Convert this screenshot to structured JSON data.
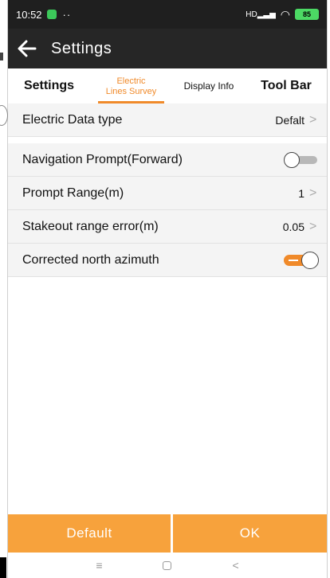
{
  "status_bar": {
    "time": "10:52",
    "dots": "··",
    "signal": "HD",
    "battery": "85"
  },
  "app_bar": {
    "title": "Settings"
  },
  "tabs": [
    {
      "label": "Settings",
      "active": false
    },
    {
      "label": "Electric Lines Survey",
      "line1": "Electric",
      "line2": "Lines Survey",
      "active": true
    },
    {
      "label": "Display Info",
      "active": false
    },
    {
      "label": "Tool Bar",
      "active": false
    }
  ],
  "rows": {
    "electric_data_type": {
      "label": "Electric Data type",
      "value": "Defalt"
    },
    "navigation_prompt": {
      "label": "Navigation Prompt(Forward)",
      "toggle": false
    },
    "prompt_range": {
      "label": "Prompt Range(m)",
      "value": "1"
    },
    "stakeout_range_error": {
      "label": "Stakeout range error(m)",
      "value": "0.05"
    },
    "corrected_north_azimuth": {
      "label": "Corrected north azimuth",
      "toggle": true
    }
  },
  "buttons": {
    "default_label": "Default",
    "ok_label": "OK"
  },
  "colors": {
    "accent": "#f08a2a",
    "button": "#f7a23c",
    "app_bar": "#262626",
    "status_bar": "#1f1f1f"
  },
  "nav_icons": [
    "menu-icon",
    "home-icon",
    "back-icon"
  ]
}
